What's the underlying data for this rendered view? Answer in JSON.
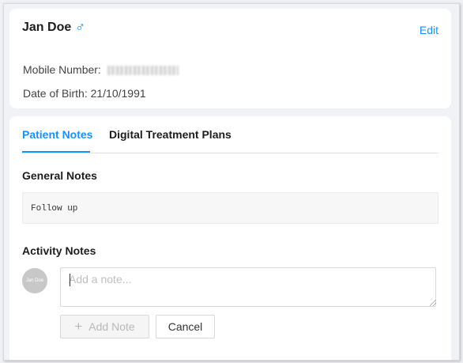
{
  "patient": {
    "name": "Jan Doe",
    "gender_icon": "male-icon",
    "gender_symbol": "♂",
    "edit_label": "Edit",
    "mobile_label": "Mobile Number:",
    "dob_label": "Date of Birth:",
    "dob_value": "21/10/1991"
  },
  "tabs": [
    {
      "label": "Patient Notes",
      "active": true
    },
    {
      "label": "Digital Treatment Plans",
      "active": false
    }
  ],
  "general_notes": {
    "title": "General Notes",
    "text": "Follow up"
  },
  "activity_notes": {
    "title": "Activity Notes",
    "avatar_text": "Jan Doe",
    "input_placeholder": "Add a note...",
    "add_button_label": "Add Note",
    "cancel_button_label": "Cancel"
  },
  "colors": {
    "accent": "#1890ff",
    "background": "#f0f2f5"
  }
}
